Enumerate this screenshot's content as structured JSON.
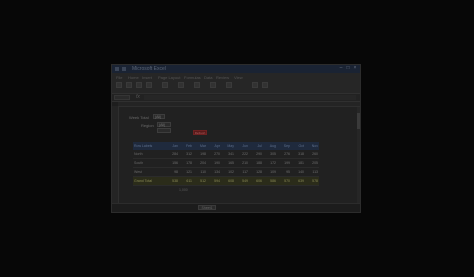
{
  "window": {
    "title": "Microsoft Excel"
  },
  "ribbon": {
    "tabs": [
      "File",
      "Home",
      "Insert",
      "Page Layout",
      "Formulas",
      "Data",
      "Review",
      "View"
    ]
  },
  "sheet_tab": "Sheet1",
  "filter": {
    "label": "Week Total",
    "value": "(All)"
  },
  "select": {
    "label": "Region",
    "value": "(All)"
  },
  "button_label": "Refresh",
  "pivot": {
    "headers": [
      "Row Labels",
      "Jan",
      "Feb",
      "Mar",
      "Apr",
      "May",
      "Jun",
      "Jul",
      "Aug",
      "Sep",
      "Oct",
      "Nov"
    ],
    "rows": [
      [
        "North",
        "284",
        "312",
        "198",
        "270",
        "341",
        "222",
        "290",
        "305",
        "276",
        "318",
        "260"
      ],
      [
        "South",
        "156",
        "178",
        "204",
        "190",
        "165",
        "210",
        "188",
        "172",
        "199",
        "181",
        "205"
      ],
      [
        "West",
        "98",
        "121",
        "110",
        "134",
        "102",
        "117",
        "128",
        "109",
        "95",
        "140",
        "113"
      ]
    ],
    "total": [
      "Grand Total",
      "538",
      "611",
      "512",
      "594",
      "608",
      "549",
      "606",
      "586",
      "570",
      "639",
      "578"
    ]
  },
  "note": "1,000"
}
